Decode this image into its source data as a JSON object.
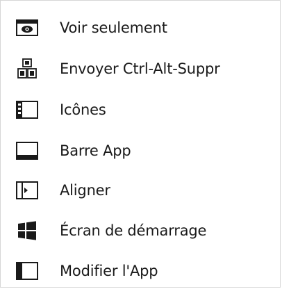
{
  "menu": {
    "items": [
      {
        "label": "Voir seulement",
        "icon": "eye-window-icon"
      },
      {
        "label": "Envoyer Ctrl-Alt-Suppr",
        "icon": "ctrl-alt-del-keys-icon"
      },
      {
        "label": "Icônes",
        "icon": "icons-panel-icon"
      },
      {
        "label": "Barre App",
        "icon": "app-bar-icon"
      },
      {
        "label": "Aligner",
        "icon": "snap-align-icon"
      },
      {
        "label": "Écran de démarrage",
        "icon": "windows-start-icon"
      },
      {
        "label": "Modifier l'App",
        "icon": "change-app-icon"
      }
    ]
  },
  "colors": {
    "icon": "#1a1a1a",
    "text": "#1a1a1a",
    "border": "#d6d6d6"
  }
}
